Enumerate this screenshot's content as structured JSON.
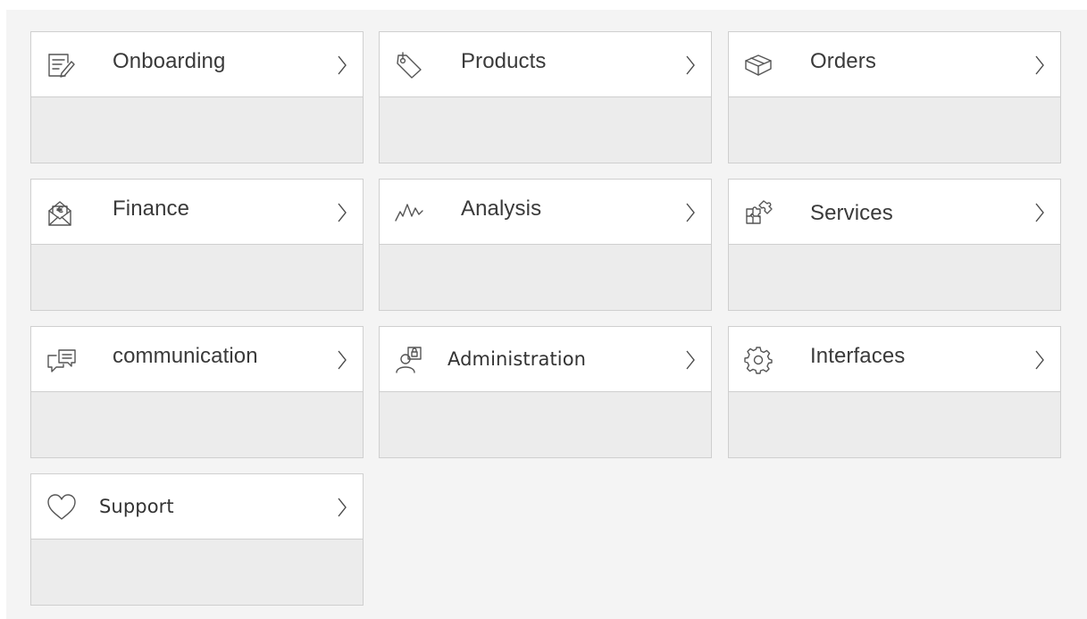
{
  "tiles": [
    {
      "id": "onboarding",
      "label": "Onboarding",
      "icon": "edit-form-icon"
    },
    {
      "id": "products",
      "label": "Products",
      "icon": "price-tag-icon"
    },
    {
      "id": "orders",
      "label": "Orders",
      "icon": "package-box-icon"
    },
    {
      "id": "finance",
      "label": "Finance",
      "icon": "euro-envelope-icon"
    },
    {
      "id": "analysis",
      "label": "Analysis",
      "icon": "line-chart-icon"
    },
    {
      "id": "services",
      "label": "Services",
      "icon": "puzzle-icon"
    },
    {
      "id": "communication",
      "label": "communication",
      "icon": "chat-bubbles-icon"
    },
    {
      "id": "administration",
      "label": "Administration",
      "icon": "admin-user-lock-icon"
    },
    {
      "id": "interfaces",
      "label": "Interfaces",
      "icon": "gear-icon"
    },
    {
      "id": "support",
      "label": "Support",
      "icon": "heart-icon"
    }
  ],
  "chevron_icon": "chevron-right-icon",
  "colors": {
    "background": "#f4f4f4",
    "tile_header": "#ffffff",
    "tile_body": "#ececec",
    "border": "#cfcfcf",
    "text": "#3a3a3a",
    "icon": "#555555"
  }
}
